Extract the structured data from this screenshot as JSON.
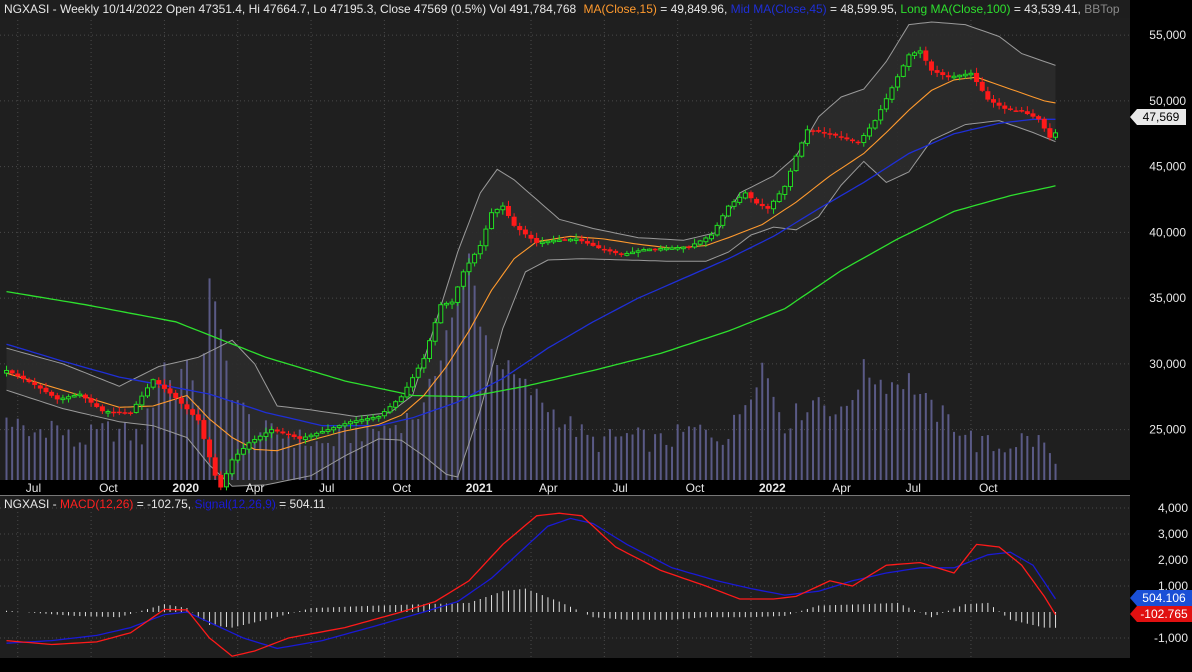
{
  "colors": {
    "background": "#1f1f1f",
    "panel_background": "#262626",
    "grid": "#4a4a4a",
    "candle_up": "#22dd22",
    "candle_down": "#ff1a1a",
    "ma_short": "#ff9a2e",
    "ma_mid": "#1f2fd6",
    "ma_long": "#2ee02e",
    "bollinger": "#9a9a9a",
    "volume": "#5a5a86",
    "macd_line": "#ff1a1a",
    "signal_line": "#1a1ad6",
    "histogram": "#e0e0e0",
    "price_tag": "#e8e8e8",
    "signal_tag": "#1a4fd6",
    "macd_tag": "#e01010"
  },
  "price_header": {
    "symbol_info": "NGXASI - Weekly 10/14/2022 Open 47351.4, Hi 47664.7, Lo 47195.3, Close 47569 (0.5%) Vol 491,784,768",
    "ma_label": "MA(Close,15)",
    "ma_value": " = 49,849.96, ",
    "mid_label": "Mid MA(Close,45)",
    "mid_value": " = 48,599.95, ",
    "long_label": "Long MA(Close,100)",
    "long_value": " = 43,539.41, ",
    "bb_label": "BBTop"
  },
  "macd_header": {
    "symbol": "NGXASI - ",
    "macd_label": "MACD(12,26)",
    "macd_value": " = -102.75, ",
    "signal_label": "Signal(12,26,9)",
    "signal_value": " = 504.11"
  },
  "price_axis": {
    "labels": [
      "55,000",
      "50,000",
      "45,000",
      "40,000",
      "35,000",
      "30,000",
      "25,000"
    ],
    "current_price_tag": "47,569"
  },
  "macd_axis": {
    "labels": [
      "4,000",
      "3,000",
      "2,000",
      "1,000",
      "-1,000"
    ],
    "signal_tag": "504.106",
    "macd_tag": "-102.765"
  },
  "time_axis": {
    "labels": [
      "Jul",
      "Oct",
      "2020",
      "Apr",
      "Jul",
      "Oct",
      "2021",
      "Apr",
      "Jul",
      "Oct",
      "2022",
      "Apr",
      "Jul",
      "Oct"
    ],
    "bold_labels": [
      "2020",
      "2021",
      "2022"
    ]
  },
  "chart_data": {
    "type": "candlestick",
    "interval": "Weekly",
    "symbol": "NGXASI",
    "ylim": [
      20000,
      56000
    ],
    "macd_ylim": [
      -1800,
      4500
    ],
    "legend": [
      "MA(Close,15)",
      "Mid MA(Close,45)",
      "Long MA(Close,100)",
      "BBTop",
      "MACD(12,26)",
      "Signal(12,26,9)"
    ],
    "last_bar": {
      "date": "10/14/2022",
      "open": 47351.4,
      "high": 47664.7,
      "low": 47195.3,
      "close": 47569,
      "change_pct": 0.5,
      "volume": 491784768
    },
    "close_anchors": [
      [
        0,
        29500
      ],
      [
        5,
        28400
      ],
      [
        9,
        27300
      ],
      [
        13,
        27700
      ],
      [
        17,
        26400
      ],
      [
        22,
        26300
      ],
      [
        26,
        28800
      ],
      [
        30,
        27400
      ],
      [
        34,
        25700
      ],
      [
        37,
        21500
      ],
      [
        38,
        20600
      ],
      [
        40,
        22700
      ],
      [
        43,
        24000
      ],
      [
        47,
        25000
      ],
      [
        52,
        24300
      ],
      [
        57,
        25000
      ],
      [
        61,
        25600
      ],
      [
        66,
        26000
      ],
      [
        70,
        27500
      ],
      [
        74,
        30400
      ],
      [
        77,
        34500
      ],
      [
        79,
        34700
      ],
      [
        81,
        37000
      ],
      [
        84,
        39000
      ],
      [
        86,
        41500
      ],
      [
        88,
        42000
      ],
      [
        90,
        40500
      ],
      [
        94,
        39200
      ],
      [
        97,
        39400
      ],
      [
        101,
        39500
      ],
      [
        105,
        38800
      ],
      [
        109,
        38300
      ],
      [
        113,
        38700
      ],
      [
        117,
        38800
      ],
      [
        121,
        38900
      ],
      [
        125,
        39800
      ],
      [
        128,
        42000
      ],
      [
        131,
        43000
      ],
      [
        133,
        42200
      ],
      [
        135,
        41800
      ],
      [
        138,
        43500
      ],
      [
        140,
        45800
      ],
      [
        142,
        47800
      ],
      [
        146,
        47500
      ],
      [
        151,
        46800
      ],
      [
        154,
        48500
      ],
      [
        157,
        51000
      ],
      [
        160,
        53500
      ],
      [
        162,
        53800
      ],
      [
        164,
        52300
      ],
      [
        167,
        51800
      ],
      [
        171,
        52100
      ],
      [
        174,
        50100
      ],
      [
        177,
        49400
      ],
      [
        180,
        49200
      ],
      [
        183,
        48600
      ],
      [
        185,
        47200
      ],
      [
        186,
        47569
      ]
    ],
    "ma_short_anchors": [
      [
        0,
        29300
      ],
      [
        10,
        28000
      ],
      [
        20,
        26700
      ],
      [
        26,
        26800
      ],
      [
        32,
        27600
      ],
      [
        36,
        25800
      ],
      [
        40,
        24400
      ],
      [
        44,
        23500
      ],
      [
        48,
        23400
      ],
      [
        54,
        24200
      ],
      [
        60,
        24900
      ],
      [
        66,
        25400
      ],
      [
        70,
        26100
      ],
      [
        74,
        27600
      ],
      [
        78,
        29800
      ],
      [
        82,
        32500
      ],
      [
        86,
        35600
      ],
      [
        90,
        38000
      ],
      [
        94,
        39300
      ],
      [
        100,
        39700
      ],
      [
        106,
        39500
      ],
      [
        112,
        39100
      ],
      [
        118,
        38800
      ],
      [
        124,
        39000
      ],
      [
        128,
        39600
      ],
      [
        134,
        40600
      ],
      [
        140,
        42300
      ],
      [
        146,
        44300
      ],
      [
        152,
        46000
      ],
      [
        156,
        47600
      ],
      [
        160,
        49300
      ],
      [
        164,
        50800
      ],
      [
        168,
        51600
      ],
      [
        172,
        51800
      ],
      [
        176,
        51200
      ],
      [
        180,
        50600
      ],
      [
        184,
        50000
      ],
      [
        186,
        49850
      ]
    ],
    "ma_mid_anchors": [
      [
        0,
        31500
      ],
      [
        10,
        30200
      ],
      [
        20,
        29000
      ],
      [
        30,
        28200
      ],
      [
        36,
        27700
      ],
      [
        46,
        26300
      ],
      [
        56,
        25300
      ],
      [
        66,
        25300
      ],
      [
        72,
        25900
      ],
      [
        80,
        27100
      ],
      [
        88,
        28900
      ],
      [
        96,
        31200
      ],
      [
        104,
        33200
      ],
      [
        112,
        35000
      ],
      [
        120,
        36500
      ],
      [
        128,
        38000
      ],
      [
        136,
        39700
      ],
      [
        144,
        41800
      ],
      [
        152,
        43800
      ],
      [
        160,
        46000
      ],
      [
        168,
        47500
      ],
      [
        176,
        48300
      ],
      [
        182,
        48600
      ],
      [
        186,
        48600
      ]
    ],
    "ma_long_anchors": [
      [
        0,
        35500
      ],
      [
        14,
        34500
      ],
      [
        30,
        33200
      ],
      [
        46,
        30500
      ],
      [
        60,
        28700
      ],
      [
        72,
        27600
      ],
      [
        82,
        27500
      ],
      [
        92,
        28300
      ],
      [
        104,
        29500
      ],
      [
        116,
        30800
      ],
      [
        128,
        32500
      ],
      [
        138,
        34200
      ],
      [
        148,
        37100
      ],
      [
        158,
        39500
      ],
      [
        168,
        41600
      ],
      [
        178,
        42800
      ],
      [
        186,
        43540
      ]
    ],
    "bb_upper_anchors": [
      [
        0,
        31200
      ],
      [
        10,
        30000
      ],
      [
        20,
        28300
      ],
      [
        27,
        29800
      ],
      [
        34,
        30500
      ],
      [
        40,
        31800
      ],
      [
        44,
        30000
      ],
      [
        48,
        26800
      ],
      [
        54,
        26500
      ],
      [
        62,
        26000
      ],
      [
        68,
        26300
      ],
      [
        72,
        27600
      ],
      [
        76,
        33000
      ],
      [
        80,
        38500
      ],
      [
        84,
        43000
      ],
      [
        87,
        44800
      ],
      [
        90,
        44000
      ],
      [
        94,
        42500
      ],
      [
        98,
        41000
      ],
      [
        104,
        40300
      ],
      [
        112,
        39600
      ],
      [
        120,
        39400
      ],
      [
        126,
        40000
      ],
      [
        130,
        43000
      ],
      [
        136,
        44300
      ],
      [
        140,
        45800
      ],
      [
        144,
        48800
      ],
      [
        148,
        50300
      ],
      [
        152,
        50900
      ],
      [
        156,
        53000
      ],
      [
        160,
        55800
      ],
      [
        164,
        56000
      ],
      [
        170,
        55800
      ],
      [
        176,
        54900
      ],
      [
        180,
        53600
      ],
      [
        186,
        52700
      ]
    ],
    "bb_lower_anchors": [
      [
        0,
        28000
      ],
      [
        10,
        26600
      ],
      [
        20,
        25600
      ],
      [
        26,
        25300
      ],
      [
        32,
        24400
      ],
      [
        36,
        22300
      ],
      [
        40,
        20700
      ],
      [
        46,
        20800
      ],
      [
        54,
        21500
      ],
      [
        60,
        23000
      ],
      [
        66,
        24300
      ],
      [
        70,
        24200
      ],
      [
        74,
        23000
      ],
      [
        78,
        21600
      ],
      [
        80,
        21400
      ],
      [
        84,
        26500
      ],
      [
        88,
        32700
      ],
      [
        92,
        37000
      ],
      [
        96,
        37900
      ],
      [
        102,
        38000
      ],
      [
        110,
        37900
      ],
      [
        118,
        37800
      ],
      [
        124,
        37800
      ],
      [
        128,
        38500
      ],
      [
        132,
        39800
      ],
      [
        136,
        40400
      ],
      [
        140,
        40200
      ],
      [
        144,
        41200
      ],
      [
        148,
        43600
      ],
      [
        152,
        45400
      ],
      [
        156,
        43800
      ],
      [
        160,
        44600
      ],
      [
        164,
        47000
      ],
      [
        170,
        48200
      ],
      [
        176,
        48500
      ],
      [
        182,
        47600
      ],
      [
        186,
        46900
      ]
    ],
    "macd_anchors": [
      [
        0,
        -1100
      ],
      [
        8,
        -1250
      ],
      [
        16,
        -1150
      ],
      [
        22,
        -800
      ],
      [
        28,
        100
      ],
      [
        32,
        80
      ],
      [
        36,
        -1000
      ],
      [
        40,
        -1700
      ],
      [
        44,
        -1500
      ],
      [
        50,
        -1000
      ],
      [
        60,
        -600
      ],
      [
        70,
        0
      ],
      [
        76,
        400
      ],
      [
        82,
        1200
      ],
      [
        88,
        2600
      ],
      [
        94,
        3700
      ],
      [
        98,
        3800
      ],
      [
        102,
        3700
      ],
      [
        108,
        2500
      ],
      [
        116,
        1600
      ],
      [
        124,
        1000
      ],
      [
        130,
        500
      ],
      [
        136,
        500
      ],
      [
        140,
        600
      ],
      [
        146,
        1200
      ],
      [
        150,
        1000
      ],
      [
        156,
        1800
      ],
      [
        162,
        1900
      ],
      [
        168,
        1500
      ],
      [
        172,
        2600
      ],
      [
        176,
        2500
      ],
      [
        180,
        1800
      ],
      [
        184,
        600
      ],
      [
        186,
        -103
      ]
    ],
    "signal_anchors": [
      [
        0,
        -1200
      ],
      [
        8,
        -1100
      ],
      [
        16,
        -900
      ],
      [
        22,
        -600
      ],
      [
        28,
        -100
      ],
      [
        32,
        0
      ],
      [
        36,
        -400
      ],
      [
        42,
        -1000
      ],
      [
        48,
        -1400
      ],
      [
        56,
        -1100
      ],
      [
        66,
        -500
      ],
      [
        74,
        0
      ],
      [
        80,
        400
      ],
      [
        86,
        1300
      ],
      [
        92,
        2500
      ],
      [
        96,
        3300
      ],
      [
        100,
        3600
      ],
      [
        104,
        3400
      ],
      [
        110,
        2600
      ],
      [
        118,
        1700
      ],
      [
        126,
        1200
      ],
      [
        132,
        900
      ],
      [
        138,
        650
      ],
      [
        144,
        800
      ],
      [
        150,
        1200
      ],
      [
        156,
        1500
      ],
      [
        162,
        1700
      ],
      [
        168,
        1700
      ],
      [
        174,
        2200
      ],
      [
        178,
        2300
      ],
      [
        182,
        1800
      ],
      [
        186,
        504
      ]
    ],
    "volume_anchors": [
      [
        0,
        26000
      ],
      [
        4,
        24500
      ],
      [
        8,
        25500
      ],
      [
        12,
        24000
      ],
      [
        18,
        25000
      ],
      [
        24,
        24500
      ],
      [
        28,
        30000
      ],
      [
        30,
        28000
      ],
      [
        32,
        31000
      ],
      [
        34,
        26000
      ],
      [
        36,
        36500
      ],
      [
        38,
        32000
      ],
      [
        40,
        28000
      ],
      [
        44,
        25000
      ],
      [
        50,
        24500
      ],
      [
        56,
        23800
      ],
      [
        62,
        24800
      ],
      [
        68,
        25200
      ],
      [
        74,
        26500
      ],
      [
        78,
        32500
      ],
      [
        80,
        35000
      ],
      [
        82,
        38000
      ],
      [
        84,
        33500
      ],
      [
        86,
        31000
      ],
      [
        90,
        29000
      ],
      [
        94,
        27500
      ],
      [
        98,
        26000
      ],
      [
        104,
        24000
      ],
      [
        110,
        24500
      ],
      [
        116,
        24000
      ],
      [
        122,
        25000
      ],
      [
        128,
        24500
      ],
      [
        134,
        30000
      ],
      [
        138,
        25500
      ],
      [
        144,
        27500
      ],
      [
        148,
        26000
      ],
      [
        152,
        29500
      ],
      [
        156,
        28500
      ],
      [
        160,
        28800
      ],
      [
        164,
        26500
      ],
      [
        168,
        25500
      ],
      [
        172,
        24000
      ],
      [
        176,
        23600
      ],
      [
        180,
        24300
      ],
      [
        184,
        24000
      ],
      [
        186,
        22000
      ]
    ],
    "histogram_anchors": [
      [
        0,
        50
      ],
      [
        12,
        -150
      ],
      [
        20,
        -200
      ],
      [
        28,
        300
      ],
      [
        32,
        150
      ],
      [
        36,
        -500
      ],
      [
        40,
        -600
      ],
      [
        46,
        -300
      ],
      [
        54,
        150
      ],
      [
        66,
        250
      ],
      [
        74,
        300
      ],
      [
        82,
        350
      ],
      [
        88,
        800
      ],
      [
        92,
        900
      ],
      [
        98,
        400
      ],
      [
        104,
        -200
      ],
      [
        110,
        -300
      ],
      [
        118,
        -300
      ],
      [
        124,
        -200
      ],
      [
        132,
        -200
      ],
      [
        138,
        -150
      ],
      [
        144,
        250
      ],
      [
        152,
        300
      ],
      [
        158,
        350
      ],
      [
        164,
        -200
      ],
      [
        170,
        300
      ],
      [
        174,
        350
      ],
      [
        178,
        -300
      ],
      [
        184,
        -600
      ],
      [
        186,
        -607
      ]
    ],
    "y_ticks": [
      55000,
      50000,
      45000,
      40000,
      35000,
      30000,
      25000
    ],
    "macd_y_ticks": [
      4000,
      3000,
      2000,
      1000,
      -1000
    ],
    "x_ticks": [
      {
        "label": "Jul",
        "bar": 2
      },
      {
        "label": "Oct",
        "bar": 15
      },
      {
        "label": "2020",
        "bar": 28
      },
      {
        "label": "Apr",
        "bar": 41
      },
      {
        "label": "Jul",
        "bar": 54
      },
      {
        "label": "Oct",
        "bar": 67
      },
      {
        "label": "2021",
        "bar": 80
      },
      {
        "label": "Apr",
        "bar": 93
      },
      {
        "label": "Jul",
        "bar": 106
      },
      {
        "label": "Oct",
        "bar": 119
      },
      {
        "label": "2022",
        "bar": 132
      },
      {
        "label": "Apr",
        "bar": 145
      },
      {
        "label": "Jul",
        "bar": 158
      },
      {
        "label": "Oct",
        "bar": 171
      }
    ]
  }
}
